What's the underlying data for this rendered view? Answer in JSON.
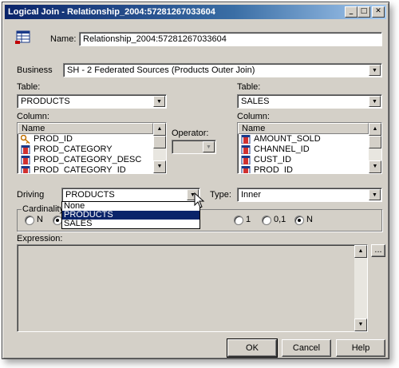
{
  "window": {
    "title": "Logical Join - Relationship_2004:57281267033604",
    "min_glyph": "_",
    "max_glyph": "□",
    "close_glyph": "✕"
  },
  "name": {
    "label": "Name:",
    "value": "Relationship_2004:57281267033604"
  },
  "business": {
    "label": "Business",
    "value": "SH - 2 Federated Sources (Products Outer Join)"
  },
  "left": {
    "table_label": "Table:",
    "table_value": "PRODUCTS",
    "column_label": "Column:",
    "header": "Name",
    "rows": [
      "PROD_ID",
      "PROD_CATEGORY",
      "PROD_CATEGORY_DESC",
      "PROD_CATEGORY_ID"
    ]
  },
  "right": {
    "table_label": "Table:",
    "table_value": "SALES",
    "column_label": "Column:",
    "header": "Name",
    "rows": [
      "AMOUNT_SOLD",
      "CHANNEL_ID",
      "CUST_ID",
      "PROD_ID"
    ]
  },
  "operator": {
    "label": "Operator:",
    "value": ""
  },
  "driving": {
    "label": "Driving",
    "value": "PRODUCTS",
    "options": [
      "None",
      "PRODUCTS",
      "SALES"
    ],
    "selected_index": 1
  },
  "type": {
    "label": "Type:",
    "value": "Inner"
  },
  "cardinality": {
    "label": "Cardinality",
    "left": [
      {
        "label": "N",
        "checked": false
      },
      {
        "label": "",
        "checked": true
      }
    ],
    "right": [
      {
        "label": "1",
        "checked": false
      },
      {
        "label": "0,1",
        "checked": false
      },
      {
        "label": "N",
        "checked": true
      }
    ]
  },
  "expression": {
    "label": "Expression:",
    "browse_label": "..."
  },
  "buttons": {
    "ok": "OK",
    "cancel": "Cancel",
    "help": "Help"
  },
  "colors": {
    "title_start": "#0a246a",
    "title_end": "#a6caf0",
    "face": "#d4d0c8",
    "selection": "#0a246a"
  }
}
